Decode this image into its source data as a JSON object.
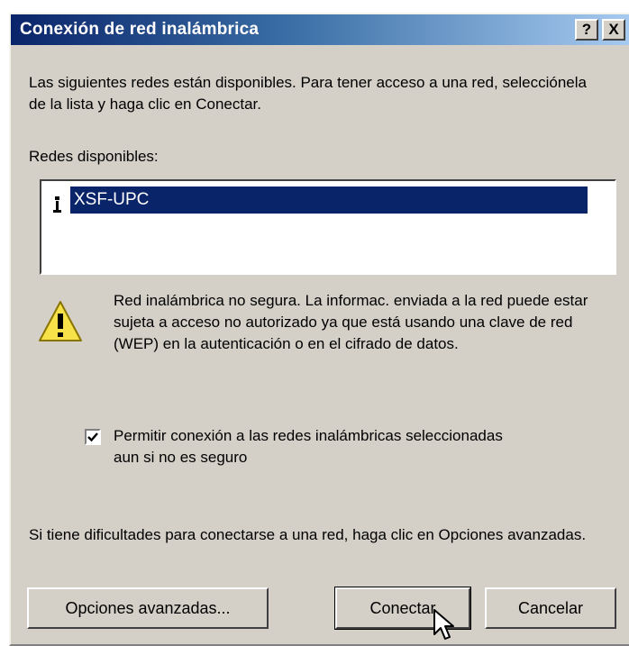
{
  "window": {
    "title": "Conexión de red inalámbrica",
    "help_button": "?",
    "close_button": "X"
  },
  "intro_text": "Las siguientes redes están disponibles. Para tener acceso a una red, selecciónela de la lista y haga clic en Conectar.",
  "networks": {
    "label": "Redes disponibles:",
    "items": [
      {
        "name": "XSF-UPC",
        "selected": true,
        "icon": "antenna-icon"
      }
    ]
  },
  "warning": {
    "icon": "warning-icon",
    "text": "Red inalámbrica no segura. La informac. enviada a la red puede estar sujeta a acceso no autorizado ya que está usando una clave de red (WEP) en la autenticación o en el cifrado de datos."
  },
  "allow_insecure": {
    "checked": true,
    "label": "Permitir conexión a las redes inalámbricas seleccionadas aun si no es seguro"
  },
  "help_text": "Si tiene dificultades para conectarse a una red, haga clic en Opciones avanzadas.",
  "buttons": {
    "advanced": "Opciones avanzadas...",
    "connect": "Conectar",
    "cancel": "Cancelar"
  },
  "colors": {
    "titlebar_start": "#0a246a",
    "titlebar_end": "#a6caf0",
    "dialog_bg": "#d4d0c8",
    "selection": "#0a246a"
  }
}
